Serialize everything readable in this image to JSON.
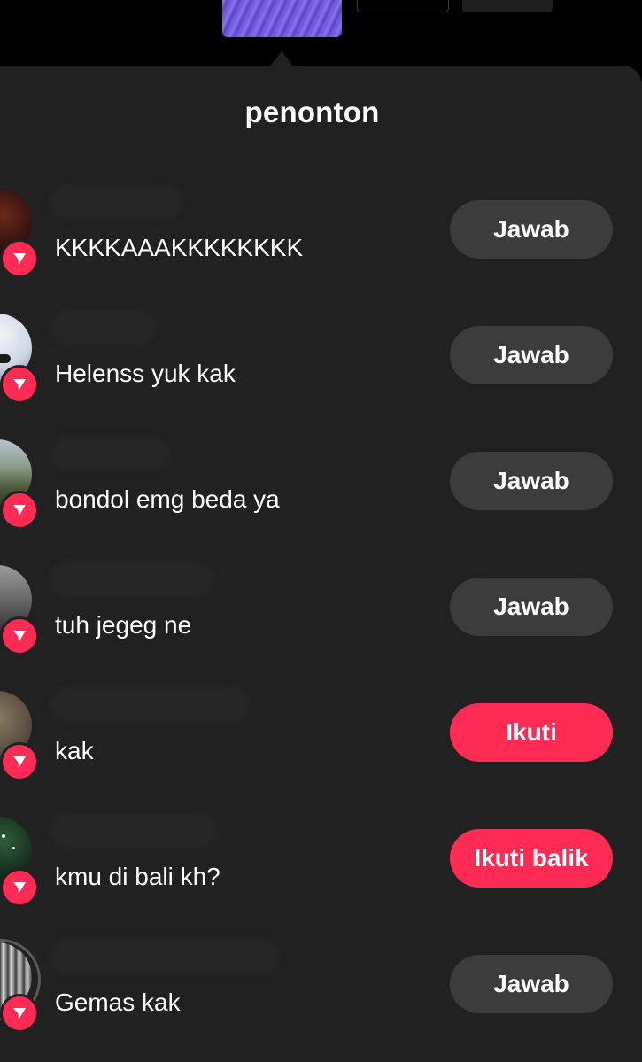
{
  "header": {
    "title": "penonton"
  },
  "colors": {
    "panel_bg": "#212121",
    "accent": "#fe2c55",
    "button_grey": "#3c3c3c"
  },
  "icons": {
    "badge": "send-arrow-icon"
  },
  "viewers": [
    {
      "message": "KKKKAAAKKKKKKKK",
      "action": "Jawab",
      "action_style": "secondary"
    },
    {
      "message": "Helenss yuk kak",
      "action": "Jawab",
      "action_style": "secondary"
    },
    {
      "message": "bondol emg beda ya",
      "action": "Jawab",
      "action_style": "secondary"
    },
    {
      "message": "tuh jegeg ne",
      "action": "Jawab",
      "action_style": "secondary"
    },
    {
      "message": "kak",
      "action": "Ikuti",
      "action_style": "primary"
    },
    {
      "message": "kmu di bali kh?",
      "action": "Ikuti balik",
      "action_style": "primary"
    },
    {
      "message": "Gemas kak",
      "action": "Jawab",
      "action_style": "secondary"
    }
  ]
}
